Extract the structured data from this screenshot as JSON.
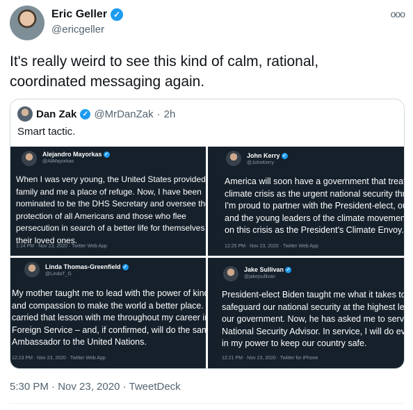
{
  "author": {
    "name": "Eric Geller",
    "handle": "@ericgeller",
    "verified_glyph": "✓"
  },
  "more_glyph": "ooo",
  "tweet_lines": [
    "It's really weird to see this kind of calm, rational,",
    "coordinated messaging again."
  ],
  "quote": {
    "name": "Dan Zak",
    "handle": "@MrDanZak",
    "separator": "·",
    "time": "2h",
    "text": "Smart tactic.",
    "panels": [
      {
        "name": "Alejandro Mayorkas",
        "handle": "@AliMayorkas",
        "lines": [
          "When I was very young, the United States provided my",
          "family and me a place of refuge. Now, I have been",
          "nominated to be the DHS Secretary and oversee the",
          "protection of all Americans and those who flee",
          "persecution in search of a better life for themselves and",
          "their loved ones."
        ],
        "meta": "1:14 PM · Nov 23, 2020 · Twitter Web App"
      },
      {
        "name": "John Kerry",
        "handle": "@JohnKerry",
        "lines": [
          "America will soon have a government that treats",
          "climate crisis as the urgent national security threat",
          "I'm proud to partner with the President-elect, our",
          "and the young leaders of the climate movement",
          "on this crisis as the President's Climate Envoy."
        ],
        "meta": "12:25 PM · Nov 23, 2020 · Twitter Web App"
      },
      {
        "name": "Linda Thomas-Greenfield",
        "handle": "@LindaT_G",
        "lines": [
          "My mother taught me to lead with the power of kindness",
          "and compassion to make the world a better place. I've",
          "carried that lesson with me throughout my career in the",
          "Foreign Service – and, if confirmed, will do the same as",
          "Ambassador to the United Nations."
        ],
        "meta": "12:23 PM · Nov 23, 2020 · Twitter Web App"
      },
      {
        "name": "Jake Sullivan",
        "handle": "@jakejsullivan",
        "lines": [
          "President-elect Biden taught me what it takes to",
          "safeguard our national security at the highest levels of",
          "our government. Now, he has asked me to serve as",
          "National Security Advisor. In service, I will do everything",
          "in my power to keep our country safe."
        ],
        "meta": "12:21 PM · Nov 23, 2020 · Twitter for iPhone"
      }
    ]
  },
  "footer": "5:30 PM · Nov 23, 2020 · TweetDeck"
}
